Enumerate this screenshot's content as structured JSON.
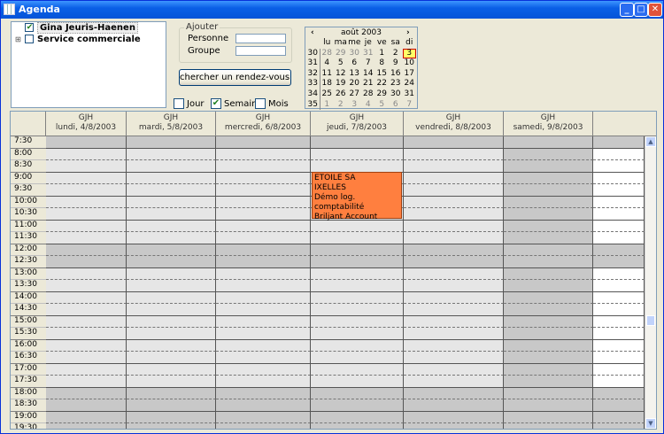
{
  "window": {
    "title": "Agenda"
  },
  "tree": {
    "items": [
      {
        "label": "Gina Jeuris-Haenen",
        "checked": true,
        "expander": ""
      },
      {
        "label": "Service commerciale",
        "checked": false,
        "expander": "⊞"
      }
    ]
  },
  "add_group": {
    "legend": "Ajouter",
    "person_label": "Personne",
    "group_label": "Groupe",
    "person_value": "",
    "group_value": ""
  },
  "search_button": {
    "label": "chercher un rendez-vous libre ‹‹"
  },
  "view_options": [
    {
      "label": "Jour",
      "checked": false
    },
    {
      "label": "Semain",
      "checked": true
    },
    {
      "label": "Mois",
      "checked": false
    }
  ],
  "calendar": {
    "month_label": "août 2003",
    "prev": "‹",
    "next": "›",
    "weekdays": [
      "",
      "lu",
      "ma",
      "me",
      "je",
      "ve",
      "sa",
      "di"
    ],
    "weeks": [
      {
        "wk": "30",
        "days": [
          "28",
          "29",
          "30",
          "31",
          "1",
          "2",
          "3"
        ]
      },
      {
        "wk": "31",
        "days": [
          "4",
          "5",
          "6",
          "7",
          "8",
          "9",
          "10"
        ]
      },
      {
        "wk": "32",
        "days": [
          "11",
          "12",
          "13",
          "14",
          "15",
          "16",
          "17"
        ]
      },
      {
        "wk": "33",
        "days": [
          "18",
          "19",
          "20",
          "21",
          "22",
          "23",
          "24"
        ]
      },
      {
        "wk": "34",
        "days": [
          "25",
          "26",
          "27",
          "28",
          "29",
          "30",
          "31"
        ]
      },
      {
        "wk": "35",
        "days": [
          "1",
          "2",
          "3",
          "4",
          "5",
          "6",
          "7"
        ]
      }
    ],
    "today": "3"
  },
  "schedule": {
    "columns": [
      {
        "user": "GJH",
        "date": "lundi, 4/8/2003"
      },
      {
        "user": "GJH",
        "date": "mardi, 5/8/2003"
      },
      {
        "user": "GJH",
        "date": "mercredi, 6/8/2003"
      },
      {
        "user": "GJH",
        "date": "jeudi, 7/8/2003"
      },
      {
        "user": "GJH",
        "date": "vendredi, 8/8/2003"
      },
      {
        "user": "GJH",
        "date": "samedi, 9/8/2003"
      }
    ],
    "times": [
      "7:30",
      "8:00",
      "8:30",
      "9:00",
      "9:30",
      "10:00",
      "10:30",
      "11:00",
      "11:30",
      "12:00",
      "12:30",
      "13:00",
      "13:30",
      "14:00",
      "14:30",
      "15:00",
      "15:30",
      "16:00",
      "16:30",
      "17:00",
      "17:30",
      "18:00",
      "18:30",
      "19:00",
      "19:30"
    ],
    "appointment": {
      "lines": [
        "ETOILE SA",
        "IXELLES",
        "Démo log. comptabilité",
        "Briljant Account"
      ],
      "color": "#ff7f3f"
    },
    "colors": {
      "work": "#e6e6e6",
      "offhours": "#c8c8c8",
      "weekend": "#c8c8c8"
    }
  }
}
